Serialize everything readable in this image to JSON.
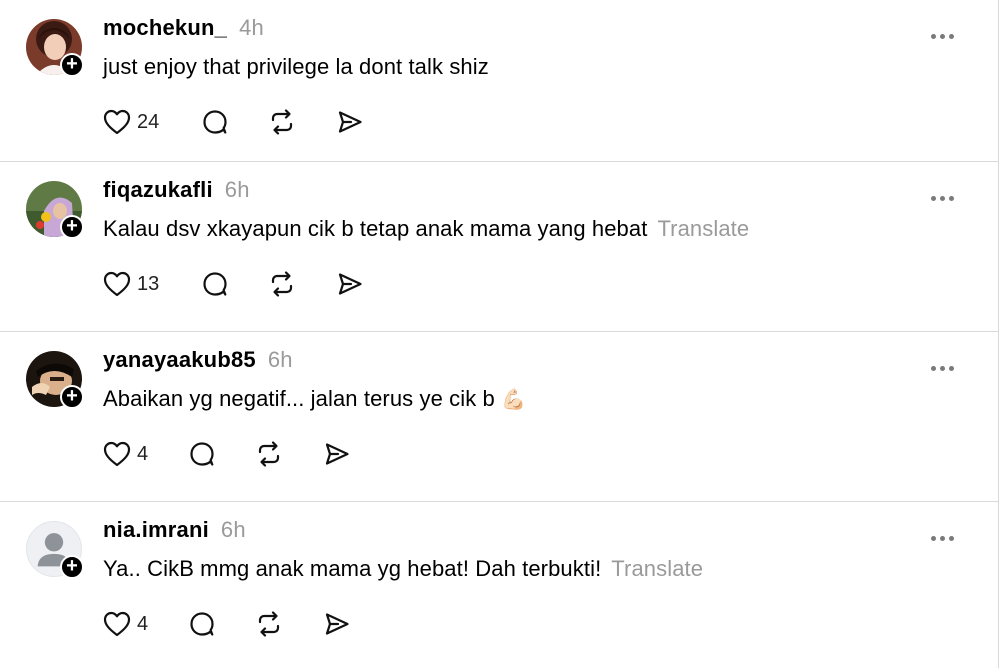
{
  "posts": [
    {
      "username": "mochekun_",
      "time": "4h",
      "text": "just enjoy that privilege la dont talk shiz",
      "translate": "",
      "likes": "24",
      "emoji": ""
    },
    {
      "username": "fiqazukafli",
      "time": "6h",
      "text": "Kalau dsv xkayapun cik b tetap anak mama yang hebat",
      "translate": "Translate",
      "likes": "13",
      "emoji": ""
    },
    {
      "username": "yanayaakub85",
      "time": "6h",
      "text": "Abaikan yg negatif... jalan terus ye cik b",
      "translate": "",
      "likes": "4",
      "emoji": "💪🏻"
    },
    {
      "username": "nia.imrani",
      "time": "6h",
      "text": "Ya.. CikB mmg anak mama yg hebat! Dah terbukti!",
      "translate": "Translate",
      "likes": "4",
      "emoji": ""
    }
  ],
  "icons": {
    "like": "heart-icon",
    "reply": "comment-icon",
    "repost": "repost-icon",
    "share": "send-icon",
    "follow": "plus-icon",
    "more": "more-icon"
  },
  "colors": {
    "muted": "#9a9a9a",
    "divider": "#d9d9d9"
  }
}
